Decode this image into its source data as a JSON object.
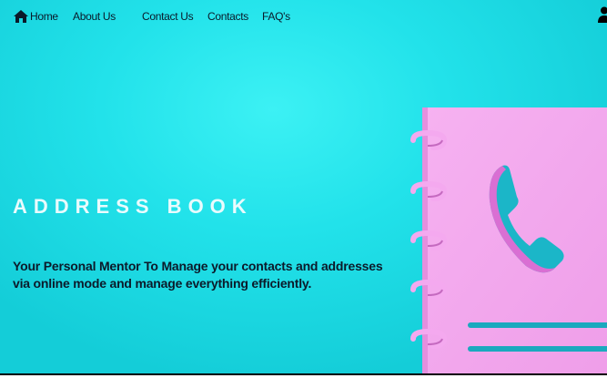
{
  "nav": {
    "items": [
      {
        "label": "Home",
        "icon": "home-icon"
      },
      {
        "label": "About Us"
      },
      {
        "label": "Contact Us"
      },
      {
        "label": "Contacts"
      },
      {
        "label": "FAQ's"
      }
    ],
    "user_icon": "user-icon"
  },
  "hero": {
    "title": "ADDRESS BOOK",
    "tagline_line1": "Your Personal Mentor To Manage your contacts and addresses",
    "tagline_line2": "via online mode and manage everything efficiently."
  },
  "colors": {
    "background": "#22e2ea",
    "book_cover": "#f2a6ee",
    "book_edge": "#d977d2",
    "title_text": "#e9fbfd"
  }
}
